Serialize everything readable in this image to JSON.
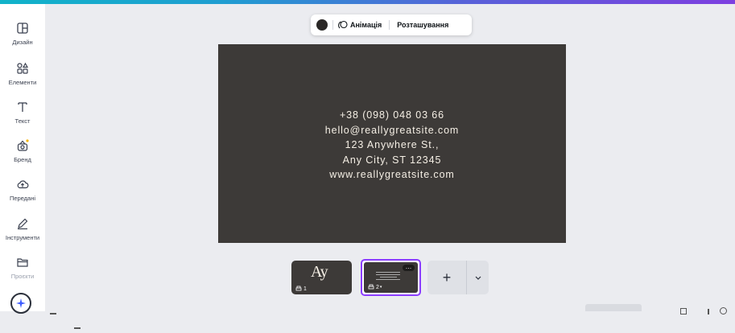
{
  "sidebar": {
    "items": [
      {
        "label": "Дизайн"
      },
      {
        "label": "Елементи"
      },
      {
        "label": "Текст"
      },
      {
        "label": "Бренд"
      },
      {
        "label": "Передані"
      },
      {
        "label": "Інструменти"
      },
      {
        "label": "Проєкти"
      }
    ]
  },
  "toolbar": {
    "animation_label": "Анімація",
    "position_label": "Розташування",
    "color": "#2a2826"
  },
  "card": {
    "lines": [
      "+38 (098) 048 03 66",
      "hello@reallygreatsite.com",
      "123 Anywhere St.,",
      "Any City, ST 12345",
      "www.reallygreatsite.com"
    ],
    "background": "#3d3a38"
  },
  "pages": {
    "thumb1_monogram": "Ay",
    "thumb1_number": "1",
    "thumb2_number": "2",
    "add_symbol": "+"
  },
  "colors": {
    "accent": "#8b3dff",
    "canvas_bg": "#ebecf0"
  }
}
